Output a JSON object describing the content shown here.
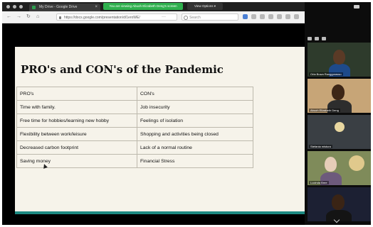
{
  "browser": {
    "tab_title": "My Drive - Google Drive",
    "tab_close": "×",
    "share_banner": "You are viewing Abuoh Elizabeth Deng's screen",
    "view_options": "View Options ▾",
    "nav": {
      "back": "←",
      "forward": "→",
      "reload": "↻",
      "home": "⌂"
    },
    "url": "https://docs.google.com/presentation/d/1eroWE/",
    "url_more": "···",
    "search_placeholder": "Search"
  },
  "slide": {
    "title": "PRO's and CON's of the Pandemic",
    "table": {
      "headers": [
        "PRO's",
        "CON's"
      ],
      "rows": [
        [
          "Time with family.",
          "Job insecurity"
        ],
        [
          "Free time for hobbies/learning new hobby",
          "Feelings of isolation"
        ],
        [
          "Flexibility between work/leisure",
          "Shopping and activities being closed"
        ],
        [
          "Decreased carbon footprint",
          "Lack of a normal routine"
        ],
        [
          "Saving money",
          "Financial Stress"
        ]
      ]
    }
  },
  "participants": [
    {
      "name": "Orla Buwa Ranggorasso"
    },
    {
      "name": "Abuoh Elizabeth Deng"
    },
    {
      "name": "Stefania mistura"
    },
    {
      "name": "Lucinda Bree"
    },
    {
      "name": ""
    }
  ],
  "colors": {
    "slide_bg": "#f6f3ea",
    "accent_teal": "#1d8a82",
    "share_green": "#2fb04e"
  }
}
